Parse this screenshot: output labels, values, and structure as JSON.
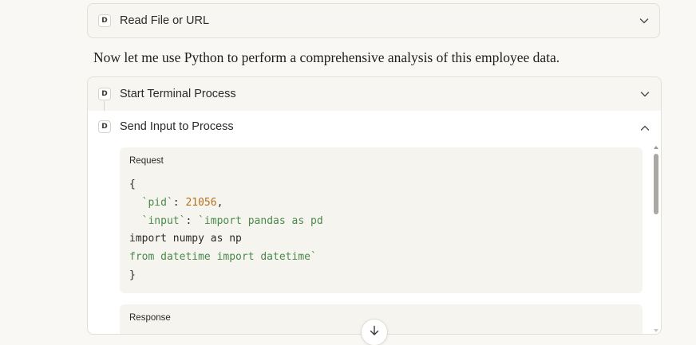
{
  "tools": {
    "read_file": {
      "badge": "D",
      "label": "Read File or URL"
    },
    "start_terminal": {
      "badge": "D",
      "label": "Start Terminal Process"
    },
    "send_input": {
      "badge": "D",
      "label": "Send Input to Process"
    }
  },
  "assistant_message": "Now let me use Python to perform a comprehensive analysis of this employee data.",
  "request": {
    "title": "Request",
    "open_brace": "{",
    "pid_key": "`pid`",
    "colon1": ": ",
    "pid_value": "21056",
    "comma": ",",
    "input_key": "`input`",
    "colon2": ": ",
    "input_line1": "`import pandas as pd",
    "input_line2": "import numpy as np",
    "input_line3": "from datetime import datetime`",
    "close_brace": "}"
  },
  "response": {
    "title": "Response"
  },
  "icons": {
    "chevron_down": "chevron-down-icon",
    "chevron_up": "chevron-up-icon",
    "arrow_down": "arrow-down-icon"
  },
  "colors": {
    "background": "#f9f8f4",
    "card": "#f7f6f2",
    "code_key": "#4a8a4a",
    "code_number": "#b5711c"
  }
}
